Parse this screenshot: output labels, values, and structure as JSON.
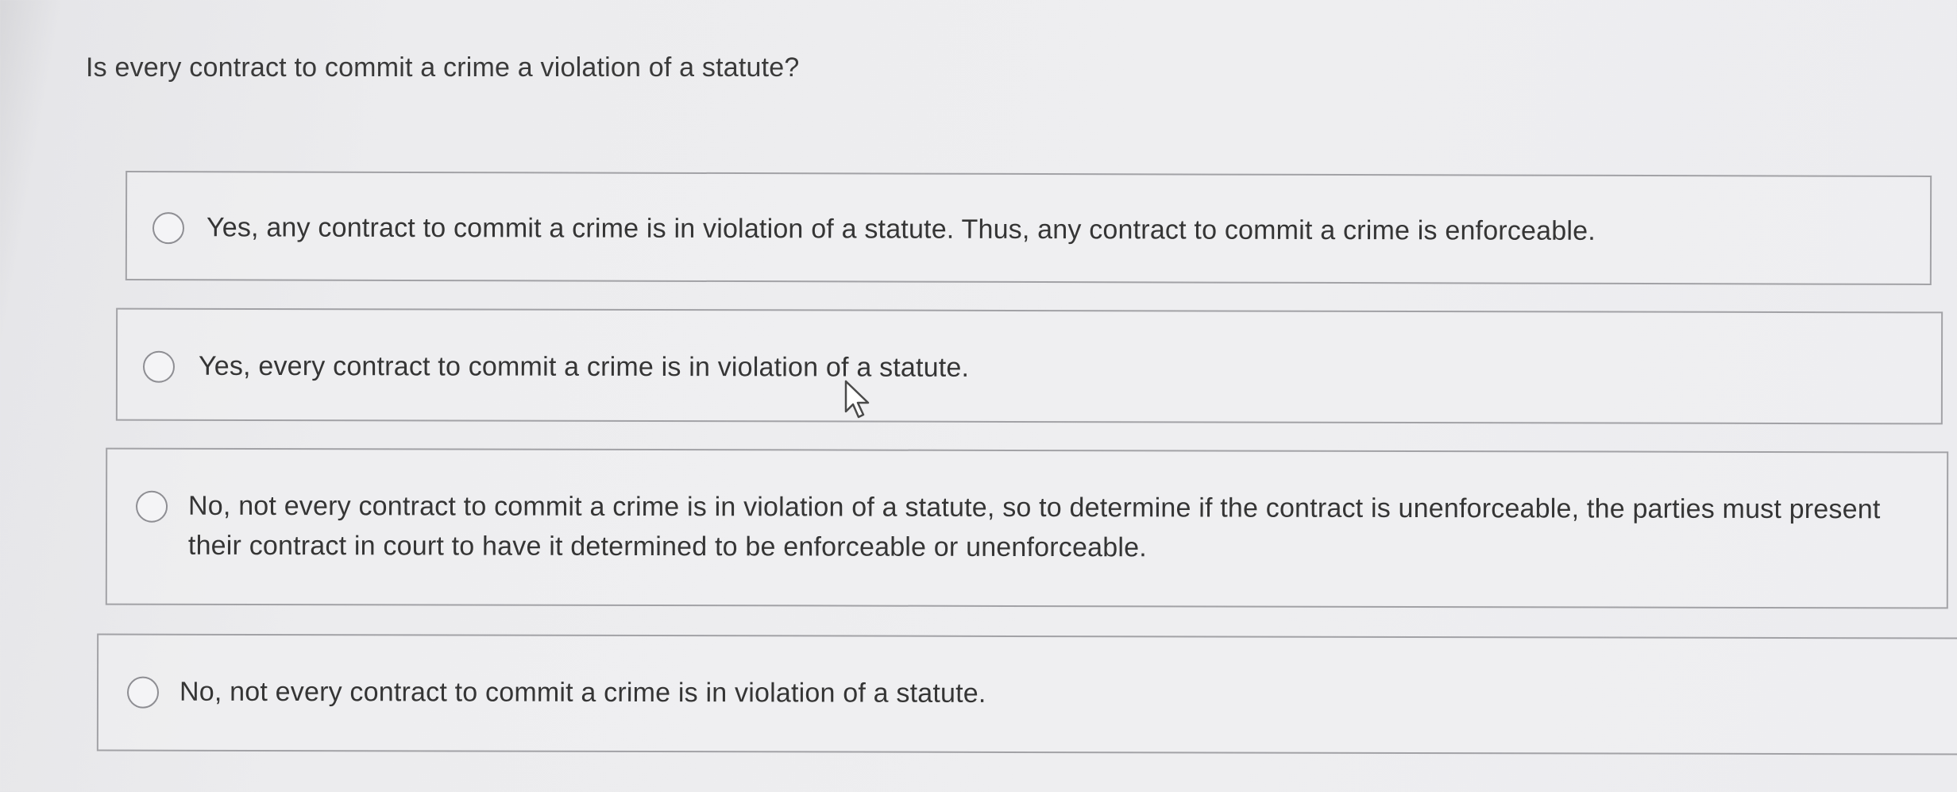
{
  "question": {
    "text": "Is every contract to commit a crime a violation of a statute?"
  },
  "choices": [
    {
      "label": "Yes, any contract to commit a crime is in violation of a statute. Thus, any contract to commit a crime is enforceable.",
      "selected": false
    },
    {
      "label": "Yes, every contract to commit a crime is in violation of a statute.",
      "selected": false
    },
    {
      "label": "No, not every contract to commit a crime is in violation of a statute, so to determine if the contract is unenforceable, the parties must present their contract in court to have it determined to be enforceable or unenforceable.",
      "selected": false
    },
    {
      "label": "No, not every contract to commit a crime is in violation of a statute.",
      "selected": false
    }
  ],
  "colors": {
    "background": "#ececee",
    "border": "#a2a2a6",
    "text": "#353535"
  },
  "icons": {
    "radio": "radio-unchecked-icon",
    "pointer": "mouse-pointer-icon"
  }
}
